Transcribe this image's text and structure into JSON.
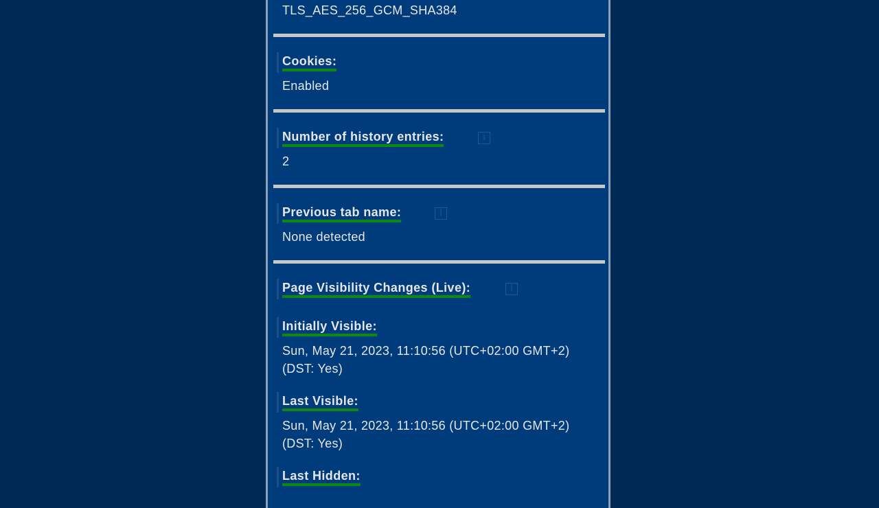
{
  "tls": {
    "cipher": "TLS_AES_256_GCM_SHA384"
  },
  "cookies": {
    "label": "Cookies:",
    "value": "Enabled"
  },
  "history": {
    "label": "Number of history entries:",
    "value": "2",
    "info_icon": "i"
  },
  "prev_tab": {
    "label": "Previous tab name:",
    "value": "None detected",
    "info_icon": "i"
  },
  "visibility": {
    "label": "Page Visibility Changes (Live):",
    "info_icon": "i",
    "initially_visible": {
      "label": "Initially Visible:",
      "line1": "Sun, May 21, 2023, 11:10:56  (UTC+02:00 GMT+2)",
      "line2": "(DST: Yes)"
    },
    "last_visible": {
      "label": "Last Visible:",
      "line1": "Sun, May 21, 2023, 11:10:56  (UTC+02:00 GMT+2)",
      "line2": "(DST: Yes)"
    },
    "last_hidden": {
      "label": "Last Hidden:"
    }
  },
  "colors": {
    "page_bg": "#002a55",
    "panel_bg": "#003c7b",
    "underline": "#0b8a12",
    "divider": "#c7c7c7"
  }
}
